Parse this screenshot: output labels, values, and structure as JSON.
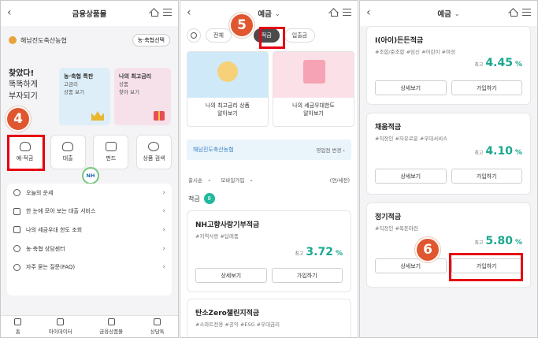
{
  "panel1": {
    "title": "금융상품몰",
    "bank_name": "해남진도축산농협",
    "bank_select": "농·축협선택",
    "hero_line1": "찾았다!",
    "hero_line2": "똑똑하게",
    "hero_line3": "부자되기",
    "card_a": {
      "title": "농·축협 특판",
      "sub1": "고금리",
      "sub2": "상품 보기"
    },
    "card_b": {
      "title": "나의 최고금리",
      "sub1": "상품",
      "sub2": "찾아 보기"
    },
    "quick": [
      "예·적금",
      "대출",
      "펀드",
      "상품 검색"
    ],
    "nh_label": "NH",
    "menu": [
      "오늘의 운세",
      "한 눈에 모아 보는 대출 서비스",
      "나의 세금우대 한도 조회",
      "농·축협 상담센터",
      "자주 묻는 질문(FAQ)"
    ],
    "bottom_nav": [
      "홈",
      "마이데이터",
      "금융상품몰",
      "상담톡"
    ],
    "step": "4"
  },
  "panel2": {
    "title": "예금",
    "tabs": [
      "전체",
      "적금",
      "입출금"
    ],
    "step": "5",
    "banner_a": {
      "line1": "나의 최고금리 상품",
      "line2": "알아보기"
    },
    "banner_b": {
      "line1": "나의 세금우대한도",
      "line2": "알아보기"
    },
    "bank_bar": "해남진도축산농협",
    "branch_change": "영업점 변경 ›",
    "filter_sort": "출시순",
    "filter_channel": "모바일가입",
    "unit": "(연/세전)",
    "count_label": "적금",
    "count": "8",
    "products": [
      {
        "name": "NH고향사랑기부적금",
        "tags": "#지역사랑 #답례품",
        "rate_label": "최고",
        "rate": "3.72",
        "pct": "%"
      },
      {
        "name": "탄소Zero챌린지적금",
        "tags": "#스마트전용 #공익 #ESG #우대금리"
      }
    ],
    "detail_btn": "상세보기",
    "join_btn": "가입하기"
  },
  "panel3": {
    "title": "예금",
    "step": "6",
    "products": [
      {
        "name": "I(아이)든든적금",
        "tags": "#조합/준조합 #임신 #어린이 #여성",
        "rate_label": "최고",
        "rate": "4.45",
        "pct": "%"
      },
      {
        "name": "채움적금",
        "tags": "#직장인 #자유로운 #우대서비스",
        "rate_label": "최고",
        "rate": "4.10",
        "pct": "%"
      },
      {
        "name": "정기적금",
        "tags": "#직장인 #목돈마련",
        "rate_label": "최고",
        "rate": "5.80",
        "pct": "%"
      }
    ],
    "detail_btn": "상세보기",
    "join_btn": "가입하기"
  },
  "colors": {
    "accent_green": "#1aa78f",
    "annotation": "#e0572f",
    "highlight_box": "#e60012"
  }
}
